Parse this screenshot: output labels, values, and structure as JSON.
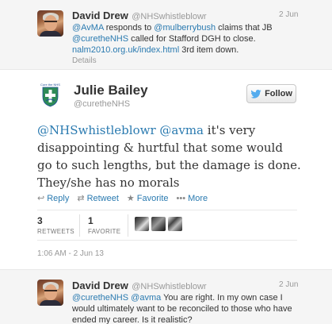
{
  "prev_tweet": {
    "name": "David Drew",
    "handle": "@NHSwhistleblowr",
    "time": "2 Jun",
    "line1_mention1": "@AvMA",
    "line1_text1": " responds to ",
    "line1_mention2": "@mulberrybush",
    "line1_text2": " claims that JB",
    "line2_mention": "@curetheNHS",
    "line2_text": " called for Stafford DGH to close.",
    "line3_link": "nalm2010.org.uk/index.html",
    "line3_text": " 3rd item down.",
    "details": "Details"
  },
  "main_tweet": {
    "name": "Julie Bailey",
    "handle": "@curetheNHS",
    "logo_text": "Cure the NHS",
    "follow_label": "Follow",
    "text_mention1": "@NHSwhistleblowr",
    "text_mention2": "@avma",
    "text_line1_rest": " it's very",
    "text_line2": "disappointing & hurtful that some would",
    "text_line3": "go to such lengths, but the damage is done.",
    "text_line4": "They/she has no morals",
    "actions": {
      "reply": "Reply",
      "retweet": "Retweet",
      "favorite": "Favorite",
      "more": "More"
    },
    "retweets_count": "3",
    "retweets_label": "RETWEETS",
    "favorites_count": "1",
    "favorites_label": "FAVORITE",
    "timestamp": "1:06 AM - 2 Jun 13"
  },
  "next_tweet": {
    "name": "David Drew",
    "handle": "@NHSwhistleblowr",
    "time": "2 Jun",
    "line1_mention1": "@curetheNHS",
    "line1_mention2": "@avma",
    "line1_text": " You are right. In my own case I",
    "line2_text": "would ultimately want to be reconciled to those who have",
    "line3_text": "ended my career. Is it realistic?"
  },
  "colors": {
    "link": "#2a7ab0",
    "muted": "#999999",
    "panel": "#f5f5f5",
    "logo_green": "#2e8b57",
    "logo_blue": "#1f4e9a"
  },
  "icons": [
    "reply-icon",
    "retweet-icon",
    "favorite-icon",
    "more-icon",
    "twitter-bird-icon"
  ]
}
